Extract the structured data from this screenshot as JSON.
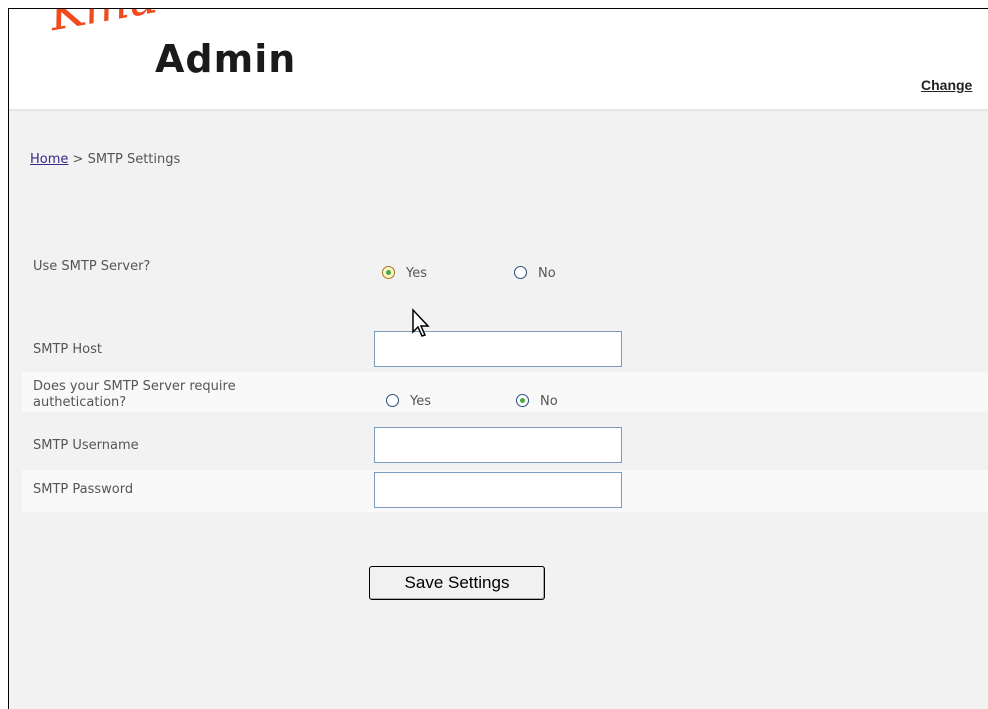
{
  "header": {
    "logo_script": "Kmu",
    "logo_title": "Admin",
    "change_link": "Change"
  },
  "breadcrumb": {
    "home": "Home",
    "separator": ">",
    "current": "SMTP Settings"
  },
  "form": {
    "use_smtp": {
      "label": "Use SMTP Server?",
      "yes": "Yes",
      "no": "No",
      "selected": "Yes"
    },
    "host": {
      "label": "SMTP Host",
      "value": ""
    },
    "auth": {
      "label_line1": "Does your SMTP Server require",
      "label_line2": "authetication?",
      "yes": "Yes",
      "no": "No",
      "selected": "No"
    },
    "username": {
      "label": "SMTP Username",
      "value": ""
    },
    "password": {
      "label": "SMTP Password",
      "value": ""
    },
    "save_label": "Save Settings"
  },
  "colors": {
    "logo_accent": "#f04a1d",
    "radio_checked_dot": "#44a944",
    "link": "#3a2a8a"
  }
}
